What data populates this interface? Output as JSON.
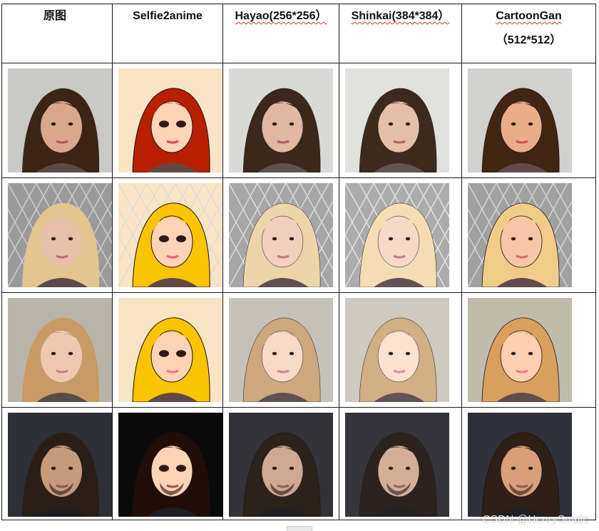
{
  "headers": [
    {
      "label": "原图",
      "sub": ""
    },
    {
      "label": "Selfie2anime",
      "sub": ""
    },
    {
      "label": "Hayao(256*256）",
      "sub": ""
    },
    {
      "label": "Shinkai(384*384）",
      "sub": ""
    },
    {
      "label": "CartoonGan",
      "sub": "（512*512）"
    }
  ],
  "rows": [
    {
      "subject": "portrait-brunette-woman",
      "bg": "#c9c9c7",
      "hair": "#3b2416",
      "skin": "#d9a88a",
      "lips": "#b0545a"
    },
    {
      "subject": "portrait-blonde-woman-fence",
      "bg": "#9a9a9a",
      "hair": "#e2c58f",
      "skin": "#e8bfa8",
      "lips": "#c56a72"
    },
    {
      "subject": "portrait-strawberry-blonde-woman",
      "bg": "#b9b4a8",
      "hair": "#c89a66",
      "skin": "#efc8b0",
      "lips": "#d37a86"
    },
    {
      "subject": "portrait-bearded-man-dark",
      "bg": "#2e2e36",
      "hair": "#2a1f18",
      "skin": "#c89a7c",
      "lips": "#8a5a52"
    }
  ],
  "styles": [
    "original",
    "selfie2anime",
    "hayao",
    "shinkai",
    "cartoongan"
  ],
  "watermark": "CSDN @HenrySmale"
}
